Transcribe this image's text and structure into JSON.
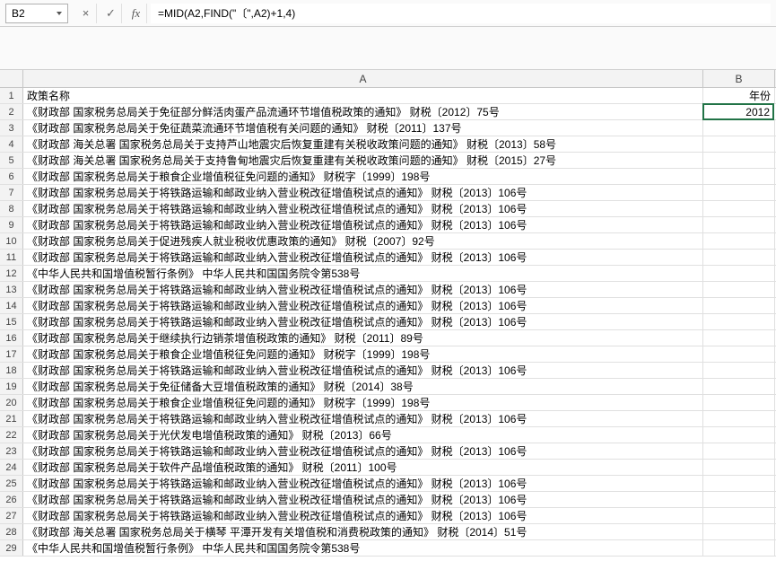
{
  "nameBox": {
    "value": "B2"
  },
  "formulaBar": {
    "cancel": "×",
    "confirm": "✓",
    "fx": "fx",
    "formula": "=MID(A2,FIND(\"〔\",A2)+1,4)"
  },
  "columns": {
    "a": "A",
    "b": "B"
  },
  "headerRow": {
    "num": "1",
    "a": "政策名称",
    "b": "年份"
  },
  "selectedCell": {
    "num": "2",
    "a": "《财政部 国家税务总局关于免征部分鲜活肉蛋产品流通环节增值税政策的通知》 财税〔2012〕75号",
    "b": "2012"
  },
  "rows": [
    {
      "num": "3",
      "a": "《财政部 国家税务总局关于免征蔬菜流通环节增值税有关问题的通知》 财税〔2011〕137号",
      "b": ""
    },
    {
      "num": "4",
      "a": "《财政部 海关总署 国家税务总局关于支持芦山地震灾后恢复重建有关税收政策问题的通知》 财税〔2013〕58号",
      "b": ""
    },
    {
      "num": "5",
      "a": "《财政部 海关总署 国家税务总局关于支持鲁甸地震灾后恢复重建有关税收政策问题的通知》 财税〔2015〕27号",
      "b": ""
    },
    {
      "num": "6",
      "a": "《财政部 国家税务总局关于粮食企业增值税征免问题的通知》 财税字〔1999〕198号",
      "b": ""
    },
    {
      "num": "7",
      "a": "《财政部 国家税务总局关于将铁路运输和邮政业纳入营业税改征增值税试点的通知》 财税〔2013〕106号",
      "b": ""
    },
    {
      "num": "8",
      "a": "《财政部 国家税务总局关于将铁路运输和邮政业纳入营业税改征增值税试点的通知》 财税〔2013〕106号",
      "b": ""
    },
    {
      "num": "9",
      "a": "《财政部 国家税务总局关于将铁路运输和邮政业纳入营业税改征增值税试点的通知》 财税〔2013〕106号",
      "b": ""
    },
    {
      "num": "10",
      "a": "《财政部 国家税务总局关于促进残疾人就业税收优惠政策的通知》 财税〔2007〕92号",
      "b": ""
    },
    {
      "num": "11",
      "a": "《财政部 国家税务总局关于将铁路运输和邮政业纳入营业税改征增值税试点的通知》 财税〔2013〕106号",
      "b": ""
    },
    {
      "num": "12",
      "a": "《中华人民共和国增值税暂行条例》 中华人民共和国国务院令第538号",
      "b": ""
    },
    {
      "num": "13",
      "a": "《财政部 国家税务总局关于将铁路运输和邮政业纳入营业税改征增值税试点的通知》 财税〔2013〕106号",
      "b": ""
    },
    {
      "num": "14",
      "a": "《财政部 国家税务总局关于将铁路运输和邮政业纳入营业税改征增值税试点的通知》 财税〔2013〕106号",
      "b": ""
    },
    {
      "num": "15",
      "a": "《财政部 国家税务总局关于将铁路运输和邮政业纳入营业税改征增值税试点的通知》 财税〔2013〕106号",
      "b": ""
    },
    {
      "num": "16",
      "a": "《财政部 国家税务总局关于继续执行边销茶增值税政策的通知》 财税〔2011〕89号",
      "b": ""
    },
    {
      "num": "17",
      "a": "《财政部 国家税务总局关于粮食企业增值税征免问题的通知》 财税字〔1999〕198号",
      "b": ""
    },
    {
      "num": "18",
      "a": "《财政部 国家税务总局关于将铁路运输和邮政业纳入营业税改征增值税试点的通知》 财税〔2013〕106号",
      "b": ""
    },
    {
      "num": "19",
      "a": "《财政部 国家税务总局关于免征储备大豆增值税政策的通知》 财税〔2014〕38号",
      "b": ""
    },
    {
      "num": "20",
      "a": "《财政部 国家税务总局关于粮食企业增值税征免问题的通知》 财税字〔1999〕198号",
      "b": ""
    },
    {
      "num": "21",
      "a": "《财政部 国家税务总局关于将铁路运输和邮政业纳入营业税改征增值税试点的通知》 财税〔2013〕106号",
      "b": ""
    },
    {
      "num": "22",
      "a": "《财政部 国家税务总局关于光伏发电增值税政策的通知》 财税〔2013〕66号",
      "b": ""
    },
    {
      "num": "23",
      "a": "《财政部 国家税务总局关于将铁路运输和邮政业纳入营业税改征增值税试点的通知》 财税〔2013〕106号",
      "b": ""
    },
    {
      "num": "24",
      "a": "《财政部 国家税务总局关于软件产品增值税政策的通知》 财税〔2011〕100号",
      "b": ""
    },
    {
      "num": "25",
      "a": "《财政部 国家税务总局关于将铁路运输和邮政业纳入营业税改征增值税试点的通知》 财税〔2013〕106号",
      "b": ""
    },
    {
      "num": "26",
      "a": "《财政部 国家税务总局关于将铁路运输和邮政业纳入营业税改征增值税试点的通知》 财税〔2013〕106号",
      "b": ""
    },
    {
      "num": "27",
      "a": "《财政部 国家税务总局关于将铁路运输和邮政业纳入营业税改征增值税试点的通知》 财税〔2013〕106号",
      "b": ""
    },
    {
      "num": "28",
      "a": "《财政部 海关总署 国家税务总局关于横琴 平潭开发有关增值税和消费税政策的通知》 财税〔2014〕51号",
      "b": ""
    },
    {
      "num": "29",
      "a": "《中华人民共和国增值税暂行条例》 中华人民共和国国务院令第538号",
      "b": ""
    }
  ]
}
